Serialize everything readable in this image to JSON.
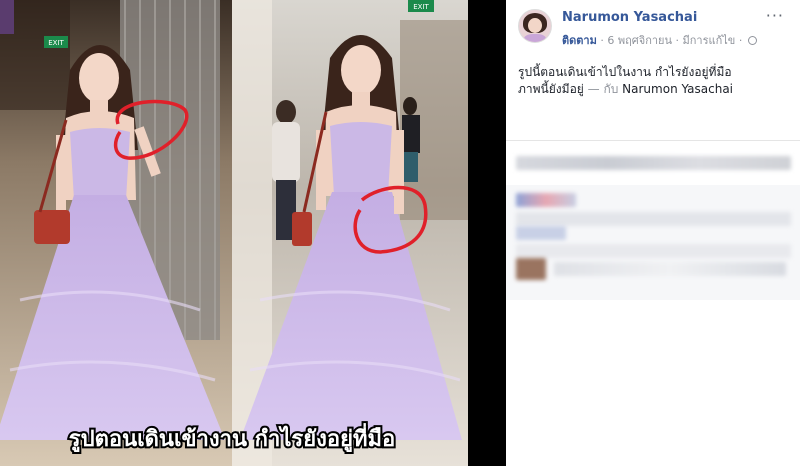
{
  "photo": {
    "overlay_text": "รูปตอนเดินเข้างาน กำไรยังอยู่ที่มือ",
    "exit_sign_left": "EXIT",
    "exit_sign_right": "EXIT"
  },
  "post": {
    "author": "Narumon Yasachai",
    "follow_label": "ติดตาม",
    "date": "6 พฤศจิกายน",
    "edited_label": "มีการแก้ไข",
    "separator": "·",
    "caption_line1": "รูปนี้ตอนเดินเข้าไปในงาน กำไรยังอยู่ที่มือ",
    "caption_line2_text": "ภาพนี้ยังมีอยู่",
    "caption_with": "— กับ",
    "caption_tag": "Narumon Yasachai",
    "menu_label": "···"
  },
  "colors": {
    "link": "#365899",
    "dress": "#c8b2e8",
    "circle": "#e0202a"
  }
}
